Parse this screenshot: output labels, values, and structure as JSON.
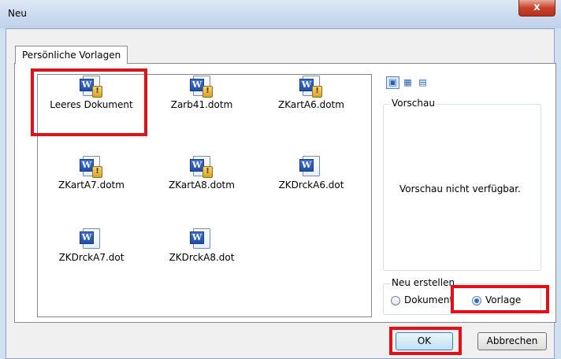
{
  "window": {
    "title": "Neu",
    "close_glyph": "x"
  },
  "tab": {
    "label": "Persönliche Vorlagen"
  },
  "templates": [
    {
      "label": "Leeres Dokument",
      "icon": "word-template-icon"
    },
    {
      "label": "Zarb41.dotm",
      "icon": "word-macro-template-icon"
    },
    {
      "label": "ZKartA6.dotm",
      "icon": "word-macro-template-icon"
    },
    {
      "label": "ZKartA7.dotm",
      "icon": "word-macro-template-icon"
    },
    {
      "label": "ZKartA8.dotm",
      "icon": "word-macro-template-icon"
    },
    {
      "label": "ZKDrckA6.dot",
      "icon": "word-template-icon"
    },
    {
      "label": "ZKDrckA7.dot",
      "icon": "word-template-icon"
    },
    {
      "label": "ZKDrckA8.dot",
      "icon": "word-template-icon"
    }
  ],
  "view_buttons": [
    "large-icons-view-icon",
    "list-view-icon",
    "details-view-icon"
  ],
  "preview": {
    "title": "Vorschau",
    "message": "Vorschau nicht verfügbar."
  },
  "create_new": {
    "title": "Neu erstellen",
    "options": [
      {
        "label": "Dokument",
        "checked": false
      },
      {
        "label": "Vorlage",
        "checked": true
      }
    ]
  },
  "buttons": {
    "ok": "OK",
    "cancel": "Abbrechen"
  },
  "colors": {
    "highlight": "#e3101a",
    "accent": "#2a6fd6"
  }
}
